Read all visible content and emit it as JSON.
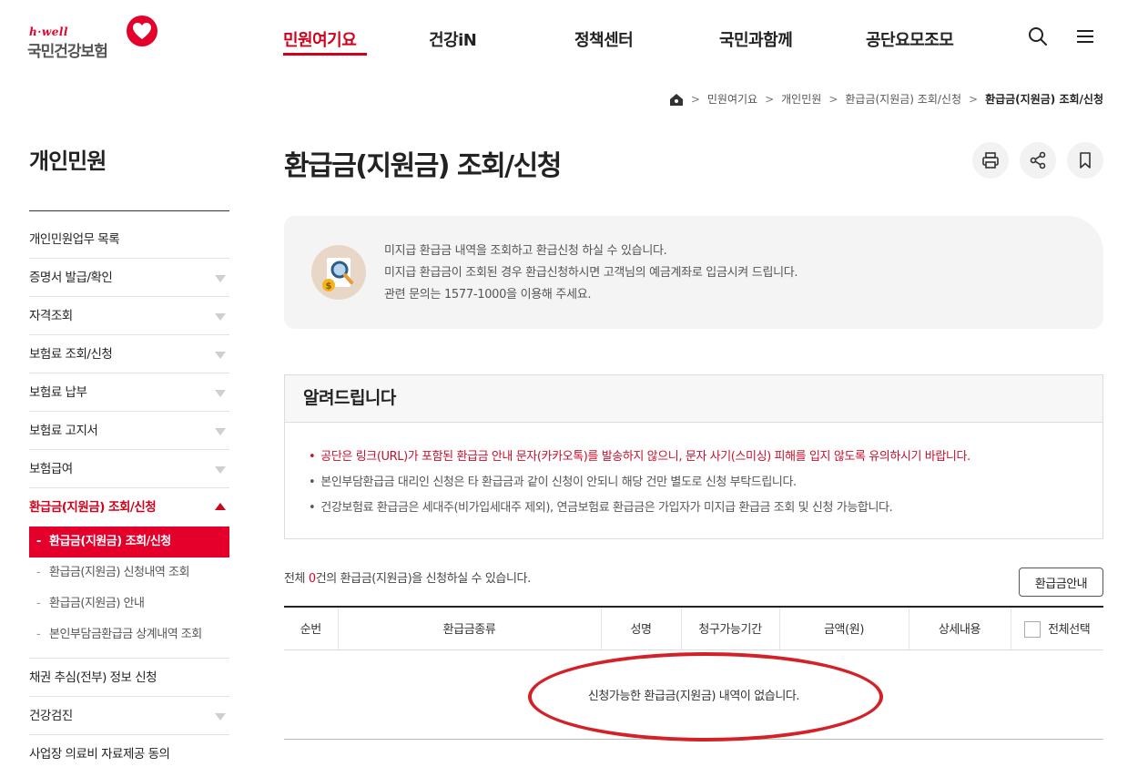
{
  "header": {
    "logo_sub": "h·well",
    "logo_name": "국민건강보험",
    "nav": [
      "민원여기요",
      "건강iN",
      "정책센터",
      "국민과함께",
      "공단요모조모"
    ],
    "icons": [
      "search-icon",
      "menu-icon"
    ]
  },
  "breadcrumb": [
    "민원여기요",
    "개인민원",
    "환급금(지원금) 조회/신청",
    "환급금(지원금) 조회/신청"
  ],
  "sidebar": {
    "title": "개인민원",
    "items": [
      {
        "label": "개인민원업무 목록"
      },
      {
        "label": "증명서 발급/확인"
      },
      {
        "label": "자격조회"
      },
      {
        "label": "보험료 조회/신청"
      },
      {
        "label": "보험료 납부"
      },
      {
        "label": "보험료 고지서"
      },
      {
        "label": "보험급여"
      },
      {
        "label": "환급금(지원금) 조회/신청"
      },
      {
        "label": "채권 추심(전부) 정보 신청"
      },
      {
        "label": "건강검진"
      },
      {
        "label": "사업장 의료비 자료제공 동의"
      }
    ],
    "sub_items": [
      {
        "label": "환급금(지원금) 조회/신청"
      },
      {
        "label": "환급금(지원금) 신청내역 조회"
      },
      {
        "label": "환급금(지원금) 안내"
      },
      {
        "label": "본인부담금환급금 상계내역 조회"
      }
    ]
  },
  "page": {
    "title": "환급금(지원금) 조회/신청",
    "tools": [
      "print-icon",
      "share-icon",
      "bookmark-icon"
    ]
  },
  "info": {
    "line1": "미지급 환급금 내역을 조회하고 환급신청 하실 수 있습니다.",
    "line2": "미지급 환급금이 조회된 경우 환급신청하시면 고객님의 예금계좌로 입금시켜 드립니다.",
    "line3": "관련 문의는 1577-1000을 이용해 주세요."
  },
  "notice": {
    "title": "알려드립니다",
    "items": [
      "공단은 링크(URL)가 포함된 환급금 안내 문자(카카오톡)를 발송하지 않으니, 문자 사기(스미싱) 피해를 입지 않도록 유의하시기 바랍니다.",
      "본인부담환급금 대리인 신청은 타 환급금과 같이 신청이 안되니 해당 건만 별도로 신청 부탁드립니다.",
      "건강보험료 환급금은 세대주(비가입세대주 제외), 연금보험료 환급금은 가입자가 미지급 환급금 조회 및 신청 가능합니다."
    ]
  },
  "summary": {
    "prefix": "전체 ",
    "count": "0",
    "suffix": "건의 환급금(지원금)을 신청하실 수 있습니다.",
    "guide_button": "환급금안내"
  },
  "table": {
    "headers": [
      "순번",
      "환급금종류",
      "성명",
      "청구가능기간",
      "금액(원)",
      "상세내용",
      "전체선택"
    ],
    "empty_message": "신청가능한 환급금(지원금) 내역이 없습니다."
  },
  "colors": {
    "brand_red": "#e4002b",
    "warning_text": "#c8102e",
    "annotation_ellipse": "#d42027"
  }
}
